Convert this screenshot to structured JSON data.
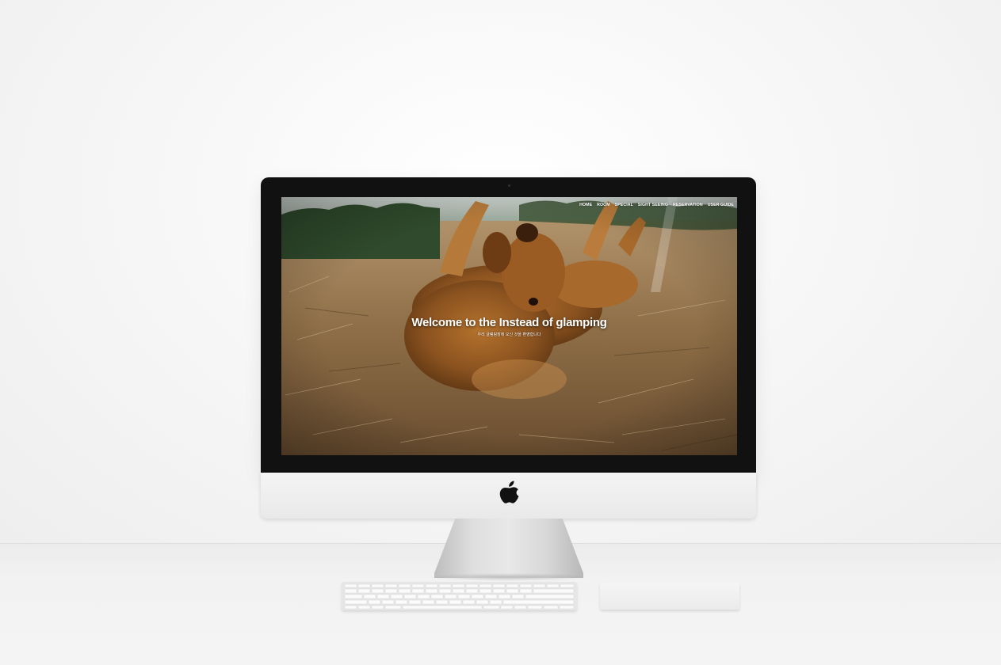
{
  "site": {
    "nav": [
      "HOME",
      "ROOM",
      "SPECIAL",
      "SIGHT SEEING",
      "RESERVATION",
      "USER GUIDE"
    ],
    "hero_title": "Welcome to the Instead of glamping",
    "hero_subtitle": "우리 글램핑장에 오신 것을 환영합니다"
  },
  "icons": {
    "logo": "apple-logo-icon"
  },
  "colors": {
    "bezel": "#111111",
    "aluminum": "#e9e9e9",
    "nav_text": "#ffffff"
  }
}
